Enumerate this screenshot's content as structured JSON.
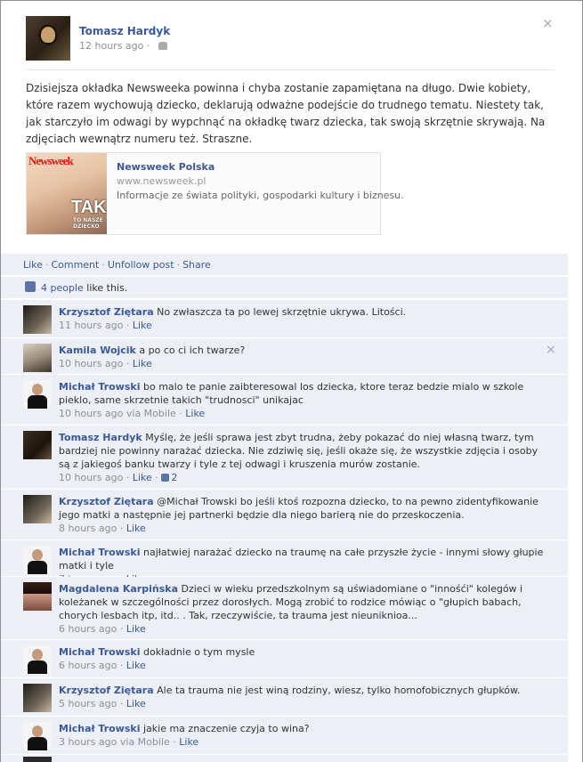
{
  "post": {
    "author": "Tomasz Hardyk",
    "time": "12 hours ago",
    "audience_icon": "friends-icon",
    "text": "Dzisiejsza okładka Newsweeka powinna i chyba zostanie zapamiętana na długo. Dwie kobiety, które razem wychowują dziecko, deklarują odważne podejście do trudnego tematu. Niestety tak, jak starczyło im odwagi by wypchnąć na okładkę twarz dziecka, tak swoją skrzętnie skrywają. Na zdjęciach wewnątrz numeru też. Straszne.",
    "link": {
      "title": "Newsweek Polska",
      "url": "www.newsweek.pl",
      "description": "Informacje ze świata polityki, gospodarki kultury i biznesu.",
      "thumb_brand": "Newsweek",
      "thumb_headline": "TAK",
      "thumb_line1": "TO NASZE",
      "thumb_line2": "DZIECKO"
    }
  },
  "actions": {
    "like": "Like",
    "comment": "Comment",
    "unfollow": "Unfollow post",
    "share": "Share",
    "separator": "·"
  },
  "likes": {
    "people": "4 people",
    "suffix": " like this."
  },
  "comments": [
    {
      "name": "Krzysztof Ziętara",
      "text": "No zwłaszcza ta po lewej skrzętnie ukrywa. Litości.",
      "time": "11 hours ago",
      "via": "",
      "like": "Like",
      "like_count": ""
    },
    {
      "name": "Kamila Wojcik",
      "text": "a po co ci ich twarze?",
      "time": "10 hours ago",
      "via": "",
      "like": "Like",
      "like_count": ""
    },
    {
      "name": "Michał Trowski",
      "text": "bo malo te panie zaibteresowal los dziecka, ktore teraz bedzie mialo w szkole pieklo, same skrzetnie takich \"trudnosci\" unikajac",
      "time": "10 hours ago",
      "via": "via Mobile",
      "like": "Like",
      "like_count": ""
    },
    {
      "name": "Tomasz Hardyk",
      "text": "Myślę, że jeśli sprawa jest zbyt trudna, żeby pokazać do niej własną twarz, tym bardziej nie powinny narażać dziecka. Nie zdziwię się, jeśli okaże się, że wszystkie zdjęcia i osoby są z jakiegoś banku twarzy i tyle z tej odwagi i kruszenia murów zostanie.",
      "time": "10 hours ago",
      "via": "",
      "like": "Like",
      "like_count": "2"
    },
    {
      "name": "Krzysztof Ziętara",
      "text": "@Michał Trowski bo jeśli ktoś rozpozna dziecko, to na pewno zidentyfikowanie jego matki a następnie jej partnerki będzie dla niego barierą nie do przeskoczenia.",
      "time": "8 hours ago",
      "via": "",
      "like": "Like",
      "like_count": ""
    },
    {
      "name": "Michał Trowski",
      "text": "najłatwiej narażać dziecko na traumę na całe przyszłe życie - innymi słowy głupie matki i tyle",
      "time": "7 hours ago",
      "via": "",
      "like": "Like",
      "like_count": ""
    },
    {
      "name": "Magdalena Karpińska",
      "text": "Dzieci w wieku przedszkolnym są uświadomiane o \"innośći\" kolegów i koleżanek w szczególności przez dorosłych. Mogą zrobić to rodzice mówiąc o \"głupich babach, chorych lesbach itp, itd.. . Tak, rzeczywiście, ta trauma jest nieuniknioa...",
      "time": "6 hours ago",
      "via": "",
      "like": "Like",
      "like_count": ""
    },
    {
      "name": "Michał Trowski",
      "text": "dokładnie o tym mysle",
      "time": "6 hours ago",
      "via": "",
      "like": "Like",
      "like_count": ""
    },
    {
      "name": "Krzysztof Ziętara",
      "text": "Ale ta trauma nie jest winą rodziny, wiesz, tylko homofobicznych głupków.",
      "time": "5 hours ago",
      "via": "",
      "like": "Like",
      "like_count": ""
    },
    {
      "name": "Michał Trowski",
      "text": "jakie ma znaczenie czyja to wina?",
      "time": "3 hours ago",
      "via": "via Mobile",
      "like": "Like",
      "like_count": ""
    }
  ],
  "close_glyph": "×"
}
